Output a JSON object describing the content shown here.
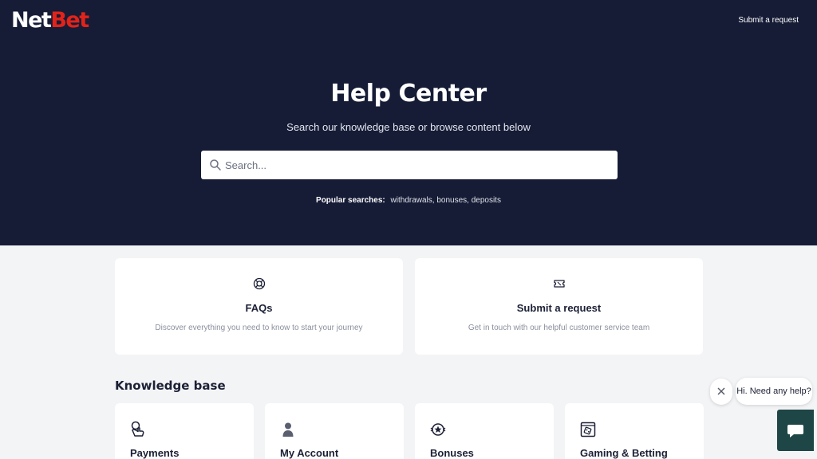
{
  "header": {
    "logo_part1": "Net",
    "logo_part2": "Bet",
    "submit_link": "Submit a request"
  },
  "hero": {
    "title": "Help Center",
    "subtitle": "Search our knowledge base or browse content below",
    "search_placeholder": "Search...",
    "popular_label": "Popular searches:",
    "popular_terms": [
      "withdrawals,",
      "bonuses,",
      "deposits"
    ]
  },
  "cards": [
    {
      "title": "FAQs",
      "description": "Discover everything you need to know to start your journey",
      "icon": "lifebuoy-icon"
    },
    {
      "title": "Submit a request",
      "description": "Get in touch with our helpful customer service team",
      "icon": "ticket-icon"
    }
  ],
  "knowledge_base": {
    "title": "Knowledge base",
    "categories": [
      {
        "title": "Payments",
        "icon": "coin-hand-icon"
      },
      {
        "title": "My Account",
        "icon": "user-icon"
      },
      {
        "title": "Bonuses",
        "icon": "star-badge-icon"
      },
      {
        "title": "Gaming & Betting",
        "icon": "dice-screen-icon"
      }
    ]
  },
  "chat": {
    "prompt": "Hi. Need any help?",
    "close_icon": "close-icon",
    "open_icon": "chat-icon"
  },
  "colors": {
    "hero_bg": "#161c36",
    "brand_red": "#e2231a",
    "chat_button": "#1e4646",
    "page_bg": "#f3f4f6"
  }
}
